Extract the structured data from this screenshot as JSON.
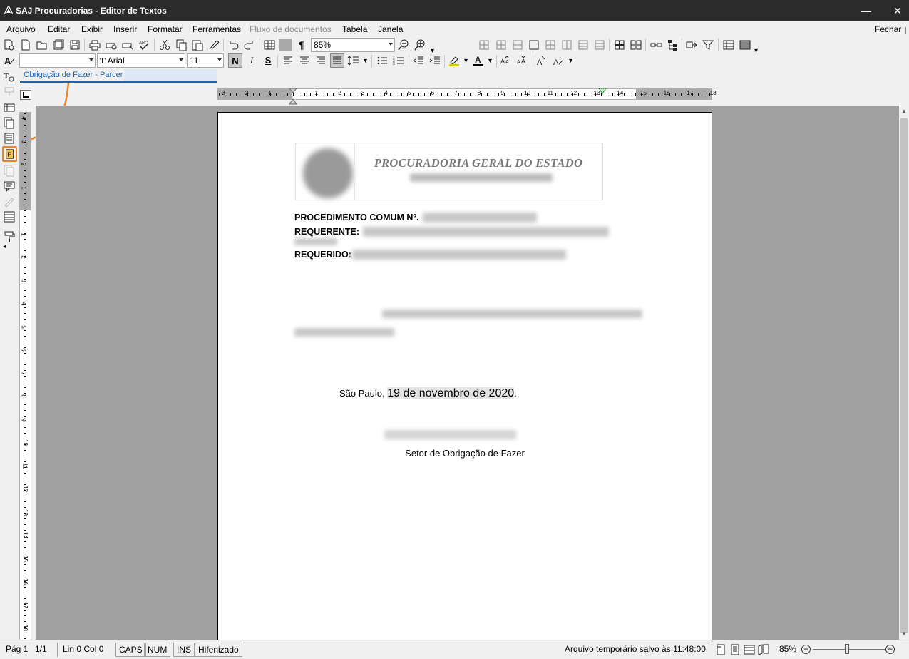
{
  "window": {
    "title": "SAJ Procuradorias - Editor de Textos",
    "minimize": "—",
    "close": "✕"
  },
  "menu": {
    "items": [
      "Arquivo",
      "Editar",
      "Exibir",
      "Inserir",
      "Formatar",
      "Ferramentas",
      "Fluxo de documentos",
      "Tabela",
      "Janela"
    ],
    "disabled_item": "Fluxo de documentos",
    "close_label": "Fechar"
  },
  "toolbar": {
    "zoom_value": "85%",
    "style_value": "",
    "font_value": "Arial",
    "font_size_value": "11",
    "bold_label": "N",
    "italic_label": "I",
    "underline_label": "S"
  },
  "document_tab": {
    "label": "Obrigação de Fazer - Parcer"
  },
  "ruler": {
    "labels": [
      "3",
      "2",
      "1",
      "1",
      "2",
      "3",
      "4",
      "5",
      "6",
      "7",
      "8",
      "9",
      "10",
      "11",
      "12",
      "13",
      "14",
      "15",
      "16",
      "17",
      "18"
    ],
    "vertical_labels": [
      "4",
      "3",
      "2",
      "1",
      "1",
      "2",
      "3",
      "4",
      "5",
      "6",
      "7",
      "8",
      "9",
      "10",
      "11",
      "12",
      "13",
      "14",
      "15",
      "16",
      "17",
      "18"
    ]
  },
  "document": {
    "header_title": "PROCURADORIA GERAL DO ESTADO",
    "procedimento_label": "PROCEDIMENTO COMUM Nº.",
    "requerente_label": "REQUERENTE:",
    "requerido_label": "REQUERIDO:",
    "city": "São Paulo, ",
    "date": "19 de novembro de 2020",
    "date_suffix": ".",
    "sector": "Setor de Obrigação de Fazer"
  },
  "status": {
    "page": "Pág 1",
    "pages": "1/1",
    "line_col": "Lin 0  Col 0",
    "caps": "CAPS",
    "num": "NUM",
    "ins": "INS",
    "hyphen": "Hifenizado",
    "saved": "Arquivo temporário salvo às 11:48:00",
    "zoom": "85%",
    "zoom_level": 0.5
  },
  "annotation": {
    "color": "#e8852a"
  }
}
